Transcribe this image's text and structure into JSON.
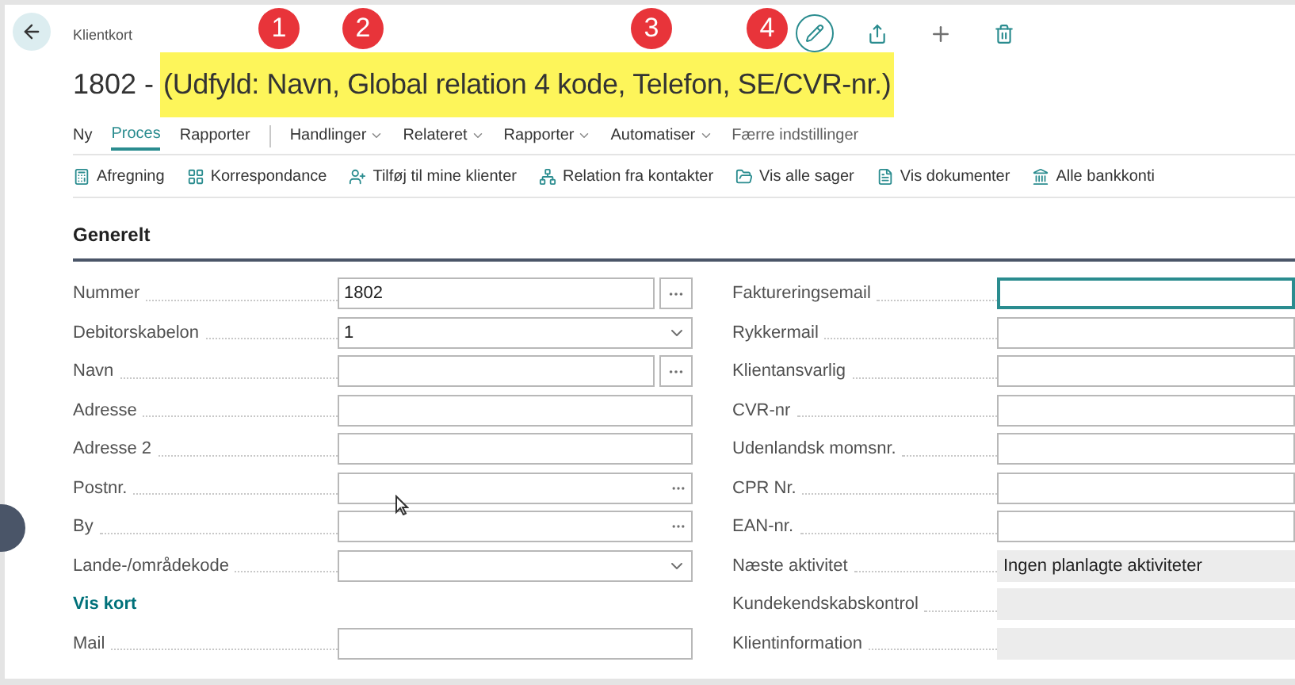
{
  "page_type": "Klientkort",
  "title": {
    "number": "1802 -",
    "note": "(Udfyld: Navn, Global relation 4 kode, Telefon, SE/CVR-nr.)"
  },
  "badges": [
    "1",
    "2",
    "3",
    "4"
  ],
  "menu": [
    {
      "label": "Ny",
      "selected": false,
      "kind": "tab"
    },
    {
      "label": "Proces",
      "selected": true,
      "kind": "tab"
    },
    {
      "label": "Rapporter",
      "selected": false,
      "kind": "tab"
    },
    {
      "label": "Handlinger",
      "selected": false,
      "kind": "dropdown"
    },
    {
      "label": "Relateret",
      "selected": false,
      "kind": "dropdown"
    },
    {
      "label": "Rapporter",
      "selected": false,
      "kind": "dropdown"
    },
    {
      "label": "Automatiser",
      "selected": false,
      "kind": "dropdown"
    },
    {
      "label": "Færre indstillinger",
      "selected": false,
      "kind": "link"
    }
  ],
  "actions": [
    {
      "label": "Afregning",
      "kind": "calculator"
    },
    {
      "label": "Korrespondance",
      "kind": "grid"
    },
    {
      "label": "Tilføj til mine klienter",
      "kind": "user"
    },
    {
      "label": "Relation fra kontakter",
      "kind": "network"
    },
    {
      "label": "Vis alle sager",
      "kind": "folder"
    },
    {
      "label": "Vis dokumenter",
      "kind": "document"
    },
    {
      "label": "Alle bankkonti",
      "kind": "bank"
    }
  ],
  "section": {
    "title": "Generelt"
  },
  "left_fields": [
    {
      "label": "Nummer",
      "kind": "lookup",
      "value": "1802"
    },
    {
      "label": "Debitorskabelon",
      "kind": "dropdown",
      "value": "1"
    },
    {
      "label": "Navn",
      "kind": "lookup"
    },
    {
      "label": "Adresse",
      "kind": "text"
    },
    {
      "label": "Adresse 2",
      "kind": "text"
    },
    {
      "label": "Postnr.",
      "kind": "assist"
    },
    {
      "label": "By",
      "kind": "assist"
    },
    {
      "label": "Lande-/områdekode",
      "kind": "dropdown"
    },
    {
      "label": "Vis kort",
      "kind": "link"
    },
    {
      "label": "Mail",
      "kind": "text"
    }
  ],
  "right_fields": [
    {
      "label": "Faktureringsemail",
      "kind": "text",
      "focused": true
    },
    {
      "label": "Rykkermail",
      "kind": "text",
      "focused": false
    },
    {
      "label": "Klientansvarlig",
      "kind": "text",
      "focused": false
    },
    {
      "label": "CVR-nr",
      "kind": "text",
      "focused": false
    },
    {
      "label": "Udenlandsk momsnr.",
      "kind": "text",
      "focused": false
    },
    {
      "label": "CPR Nr.",
      "kind": "text",
      "focused": false
    },
    {
      "label": "EAN-nr.",
      "kind": "text",
      "focused": false
    },
    {
      "label": "Næste aktivitet",
      "kind": "readonly",
      "value": "Ingen planlagte aktiviteter"
    },
    {
      "label": "Kundekendskabskontrol",
      "kind": "readonly"
    },
    {
      "label": "Klientinformation",
      "kind": "readonly"
    }
  ]
}
